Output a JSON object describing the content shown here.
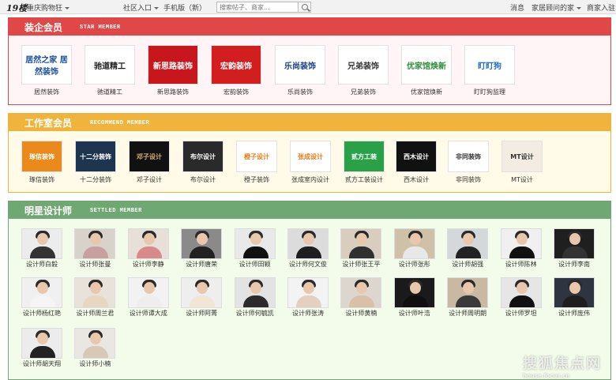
{
  "topbar": {
    "logo": "19楼",
    "city": "重庆购物狂",
    "community": "社区入口",
    "mobile": "手机版（新）",
    "search_placeholder": "搜索帖子、商家...",
    "messages": "消息",
    "home_advisor": "家居顾问的家",
    "merchant": "商家入驻"
  },
  "star": {
    "title": "装企会员",
    "subtitle": "STAR MEMBER",
    "close": "✕",
    "members": [
      {
        "name": "居然装饰",
        "logo_text": "居然之家 居然装饰",
        "bg": "#ffffff",
        "fg": "#1b4f9c"
      },
      {
        "name": "驰道精工",
        "logo_text": "驰道精工",
        "bg": "#ffffff",
        "fg": "#222222"
      },
      {
        "name": "新思路装饰",
        "logo_text": "新思路装饰",
        "bg": "#c8161d",
        "fg": "#ffffff"
      },
      {
        "name": "宏韵装饰",
        "logo_text": "宏韵装饰",
        "bg": "#d21e1e",
        "fg": "#ffffff"
      },
      {
        "name": "乐尚装饰",
        "logo_text": "乐尚装饰",
        "bg": "#ffffff",
        "fg": "#1a3e8c"
      },
      {
        "name": "兄弟装饰",
        "logo_text": "兄弟装饰",
        "bg": "#ffffff",
        "fg": "#333333"
      },
      {
        "name": "优家馆焕新",
        "logo_text": "优家馆焕新",
        "bg": "#ffffff",
        "fg": "#2d8f3a"
      },
      {
        "name": "盯盯狗监理",
        "logo_text": "盯盯狗",
        "bg": "#ffffff",
        "fg": "#1d6fc4"
      }
    ]
  },
  "studio": {
    "title": "工作室会员",
    "subtitle": "RECOMMEND MEMBER",
    "members": [
      {
        "name": "琢信装饰",
        "logo_text": "琢信装饰",
        "bg": "#e98a1b",
        "fg": "#ffffff"
      },
      {
        "name": "十二分装饰",
        "logo_text": "十二分装饰",
        "bg": "#1e3550",
        "fg": "#ffffff"
      },
      {
        "name": "邓子设计",
        "logo_text": "邓子设计",
        "bg": "#111111",
        "fg": "#d9b46a"
      },
      {
        "name": "布尔设计",
        "logo_text": "布尔设计",
        "bg": "#2a2a2a",
        "fg": "#ffffff"
      },
      {
        "name": "橙子装饰",
        "logo_text": "橙子设计",
        "bg": "#ffffff",
        "fg": "#e87a14"
      },
      {
        "name": "张成室内设计",
        "logo_text": "张成设计",
        "bg": "#ffffff",
        "fg": "#e87a14"
      },
      {
        "name": "贰方工装设计",
        "logo_text": "贰方工装",
        "bg": "#2aa149",
        "fg": "#ffffff"
      },
      {
        "name": "西木设计",
        "logo_text": "西木设计",
        "bg": "#111111",
        "fg": "#ffffff"
      },
      {
        "name": "非同装饰",
        "logo_text": "非同装饰",
        "bg": "#ffffff",
        "fg": "#333333"
      },
      {
        "name": "MT设计",
        "logo_text": "MT设计",
        "bg": "#f3ece3",
        "fg": "#333333"
      }
    ]
  },
  "designers": {
    "title": "明星设计师",
    "subtitle": "SETTLED MEMBER",
    "people": [
      {
        "name": "设计师白毅",
        "bg": "#ececec",
        "cloth": "#333333"
      },
      {
        "name": "设计师张曼",
        "bg": "#d8d2cb",
        "cloth": "#c9a0a0"
      },
      {
        "name": "设计师李静",
        "bg": "#e6e0d8",
        "cloth": "#d88a8a"
      },
      {
        "name": "设计师唐荣",
        "bg": "#8a8a8a",
        "cloth": "#222222"
      },
      {
        "name": "设计师田颖",
        "bg": "#e9e9e9",
        "cloth": "#111111"
      },
      {
        "name": "设计师何文俊",
        "bg": "#dcdcdc",
        "cloth": "#1f1f1f"
      },
      {
        "name": "设计师张王平",
        "bg": "#d9cdbf",
        "cloth": "#2f2f2f"
      },
      {
        "name": "设计师张彤",
        "bg": "#cfc1a8",
        "cloth": "#e8e8e8"
      },
      {
        "name": "设计师胡强",
        "bg": "#d5d8db",
        "cloth": "#222222"
      },
      {
        "name": "设计师陈林",
        "bg": "#f0f0f0",
        "cloth": "#111111"
      },
      {
        "name": "设计师李南",
        "bg": "#1f1f1f",
        "cloth": "#333333"
      },
      {
        "name": "设计师杨红艳",
        "bg": "#f0f0f0",
        "cloth": "#f5f5f5"
      },
      {
        "name": "设计师周兰君",
        "bg": "#e8e2da",
        "cloth": "#e8d7c0"
      },
      {
        "name": "设计师谭大成",
        "bg": "#f2f2f2",
        "cloth": "#eeeeee"
      },
      {
        "name": "设计师阿菁",
        "bg": "#eeeeee",
        "cloth": "#f1e6d6"
      },
      {
        "name": "设计师何毓凯",
        "bg": "#e3e3e3",
        "cloth": "#2b2b2b"
      },
      {
        "name": "设计师张涛",
        "bg": "#f3f3f3",
        "cloth": "#e4d0c0"
      },
      {
        "name": "设计师黄楠",
        "bg": "#dcd6cf",
        "cloth": "#d9c0a8"
      },
      {
        "name": "设计师叶浩",
        "bg": "#1a1a1a",
        "cloth": "#0f0f0f"
      },
      {
        "name": "设计师周明朗",
        "bg": "#c9b9a2",
        "cloth": "#3a3a3a"
      },
      {
        "name": "设计师罗坦",
        "bg": "#e6e6e6",
        "cloth": "#111111"
      },
      {
        "name": "设计师庞伟",
        "bg": "#2e3440",
        "cloth": "#1e1e1e"
      },
      {
        "name": "设计师胡天翔",
        "bg": "#ececec",
        "cloth": "#222222"
      },
      {
        "name": "设计师小楠",
        "bg": "#eae6e1",
        "cloth": "#d8c8b8"
      }
    ]
  },
  "watermark": {
    "big": "搜狐焦点网",
    "small": "house.focus.cn"
  }
}
